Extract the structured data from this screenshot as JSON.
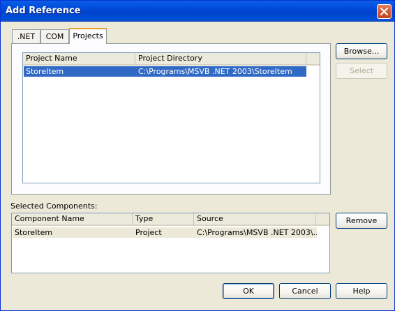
{
  "window": {
    "title": "Add Reference",
    "close_label": "×"
  },
  "tabs": [
    {
      "label": ".NET"
    },
    {
      "label": "COM"
    },
    {
      "label": "Projects",
      "active": true
    }
  ],
  "projects_list": {
    "columns": [
      "Project Name",
      "Project Directory"
    ],
    "rows": [
      {
        "name": "StoreItem",
        "directory": "C:\\Programs\\MSVB .NET 2003\\StoreItem",
        "selected": true
      }
    ]
  },
  "side_buttons": {
    "browse": "Browse...",
    "select": "Select",
    "remove": "Remove"
  },
  "selected_components": {
    "label": "Selected Components:",
    "columns": [
      "Component Name",
      "Type",
      "Source"
    ],
    "rows": [
      {
        "name": "StoreItem",
        "type": "Project",
        "source": "C:\\Programs\\MSVB .NET 2003\\..."
      }
    ]
  },
  "footer_buttons": {
    "ok": "OK",
    "cancel": "Cancel",
    "help": "Help"
  },
  "colors": {
    "title_bar": "#0148d6",
    "selection": "#316ac5",
    "dialog_bg": "#ece9d8"
  }
}
